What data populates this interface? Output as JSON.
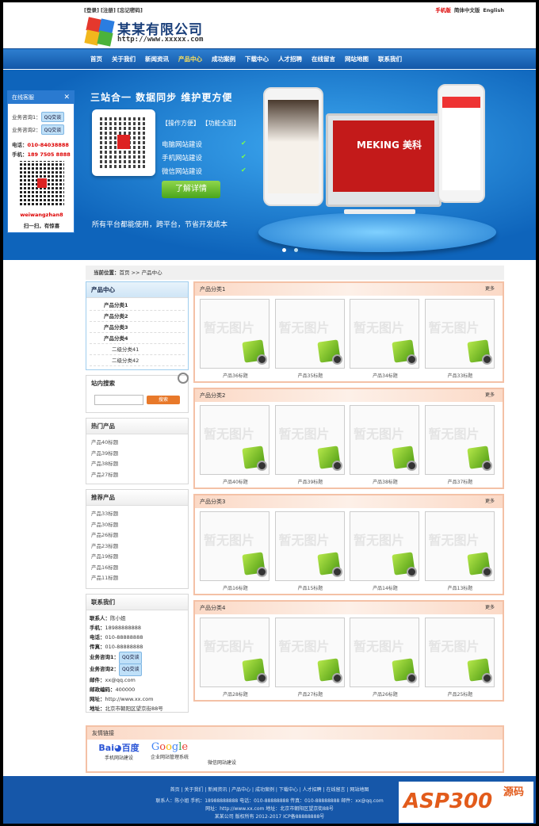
{
  "top": {
    "login": "[登录]",
    "register": "[注册]",
    "forgot": "[忘记密码]",
    "mobile": "手机版",
    "simplified": "简体中文版",
    "english": "English"
  },
  "logo": {
    "name": "某某有限公司",
    "url": "http://www.xxxxx.com"
  },
  "nav": [
    "首页",
    "关于我们",
    "新闻资讯",
    "产品中心",
    "成功案例",
    "下载中心",
    "人才招聘",
    "在线留言",
    "网站地图",
    "联系我们"
  ],
  "nav_active": 3,
  "banner": {
    "slogan": "三站合一  数据同步  维护更方便",
    "tags": "【操作方便】 【功能全面】",
    "features": [
      "电脑网站建设",
      "手机网站建设",
      "微信网站建设"
    ],
    "button": "了解详情",
    "sub": "所有平台都能使用，跨平台，节省开发成本",
    "imac_brand": "MEKING 美科",
    "slide_count": 2,
    "slide_active": 0
  },
  "service": {
    "title": "在线客服",
    "close": "✕",
    "consult1": "业务咨询1：",
    "consult2": "业务咨询2：",
    "qq": "QQ交谈",
    "tel_label": "电话：",
    "tel": "010-84038888",
    "mobile_label": "手机：",
    "mobile": "189 7505 8888",
    "wechat": "weiwangzhan8",
    "scan": "扫一扫，有惊喜"
  },
  "crumb": {
    "label": "当前位置：",
    "home": "首页",
    "sep": ">>",
    "current": "产品中心"
  },
  "category": {
    "title": "产品中心",
    "items": [
      {
        "label": "产品分类1",
        "sub": false
      },
      {
        "label": "产品分类2",
        "sub": false
      },
      {
        "label": "产品分类3",
        "sub": false
      },
      {
        "label": "产品分类4",
        "sub": false
      },
      {
        "label": "二级分类41",
        "sub": true
      },
      {
        "label": "二级分类42",
        "sub": true
      }
    ]
  },
  "search": {
    "title": "站内搜索",
    "button": "搜索"
  },
  "hot": {
    "title": "热门产品",
    "items": [
      "产品40标题",
      "产品39标题",
      "产品38标题",
      "产品27标题"
    ]
  },
  "recommend": {
    "title": "推荐产品",
    "items": [
      "产品33标题",
      "产品30标题",
      "产品26标题",
      "产品23标题",
      "产品19标题",
      "产品16标题",
      "产品11标题"
    ]
  },
  "contact": {
    "title": "联系我们",
    "rows": [
      {
        "k": "联系人：",
        "v": "陈小姐"
      },
      {
        "k": "手机：",
        "v": "18988888888"
      },
      {
        "k": "电话：",
        "v": "010-88888888"
      },
      {
        "k": "传真：",
        "v": "010-88888888"
      },
      {
        "k": "业务咨询1：",
        "v": "QQ交谈",
        "qq": true
      },
      {
        "k": "业务咨询2：",
        "v": "QQ交谈",
        "qq": true
      },
      {
        "k": "邮件：",
        "v": "xx@qq.com"
      },
      {
        "k": "邮政编码：",
        "v": "400000"
      },
      {
        "k": "网址：",
        "v": "http://www.xx.com"
      },
      {
        "k": "地址：",
        "v": "北京市朝阳区望京街88号"
      }
    ]
  },
  "noimg": "暂无图片",
  "sections": [
    {
      "title": "产品分类1",
      "more": "更多",
      "items": [
        "产品36标题",
        "产品35标题",
        "产品34标题",
        "产品33标题"
      ]
    },
    {
      "title": "产品分类2",
      "more": "更多",
      "items": [
        "产品40标题",
        "产品39标题",
        "产品38标题",
        "产品37标题"
      ]
    },
    {
      "title": "产品分类3",
      "more": "更多",
      "items": [
        "产品16标题",
        "产品15标题",
        "产品14标题",
        "产品13标题"
      ]
    },
    {
      "title": "产品分类4",
      "more": "更多",
      "items": [
        "产品28标题",
        "产品27标题",
        "产品26标题",
        "产品25标题"
      ]
    }
  ],
  "links": {
    "title": "友情链接",
    "items": [
      "手机网站建设",
      "企业网站管理系统",
      "微信网站建设"
    ],
    "baidu_a": "Bai",
    "baidu_b": "du",
    "baidu_c": "百度",
    "google": "Google"
  },
  "footer": {
    "nav": "首页 | 关于我们 | 新闻资讯 | 产品中心 | 成功案例 | 下载中心 | 人才招聘 | 在线留言 | 网站地图",
    "line2": "联系人：陈小姐   手机：18988888888   电话：010-88888888   传真：010-88888888   邮件：xx@qq.com",
    "line3": "网址：http://www.xx.com   地址：北京市朝阳区望京街88号",
    "line4": "某某公司  版权所有 2012-2017 ICP备88888888号"
  },
  "watermark": {
    "a": "ASP300",
    "b": "源码"
  },
  "colors": {
    "nav": "#1257a8",
    "accent": "#ffe25a",
    "section_border": "#f4c1a6",
    "button": "#4aa51c"
  }
}
